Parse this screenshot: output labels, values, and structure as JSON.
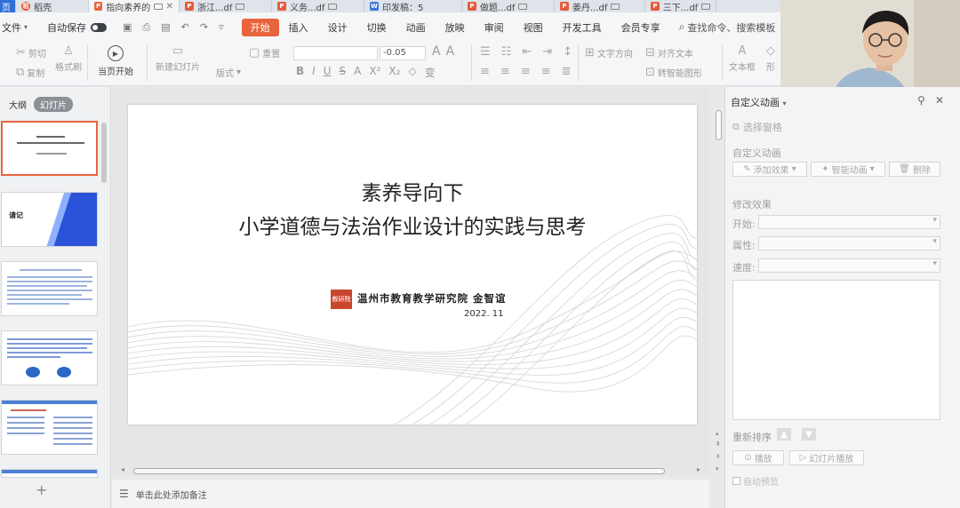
{
  "tabs": [
    {
      "label": "页",
      "type": "home"
    },
    {
      "label": "稻壳",
      "type": "brand"
    },
    {
      "label": "指向素养的",
      "type": "ppt",
      "active": true
    },
    {
      "label": "浙江...df",
      "type": "pdf"
    },
    {
      "label": "义务...df",
      "type": "pdf"
    },
    {
      "label": "印发稿：5",
      "type": "doc"
    },
    {
      "label": "做题...df",
      "type": "pdf"
    },
    {
      "label": "姜丹...df",
      "type": "pdf"
    },
    {
      "label": "三下...df",
      "type": "pdf"
    }
  ],
  "menubar": {
    "file_label": "文件",
    "autosave_label": "自动保存",
    "items": [
      "开始",
      "插入",
      "设计",
      "切换",
      "动画",
      "放映",
      "审阅",
      "视图",
      "开发工具",
      "会员专享"
    ],
    "active_index": 0,
    "search_placeholder": "查找命令、搜索模板"
  },
  "ribbon": {
    "cut": "剪切",
    "copy": "复制",
    "format_painter": "格式刷",
    "from_current": "当页开始",
    "new_slide": "新建幻灯片",
    "layout": "版式",
    "reset": "重置",
    "font_size_delta": "-0.05",
    "textbox_dir": "文字方向",
    "align_text": "对齐文本",
    "smartart": "转智能图形",
    "textbox": "文本框",
    "shape": "形"
  },
  "left_panel": {
    "tab_outline": "大纲",
    "tab_slides": "幻灯片",
    "thumb2_text": "请记",
    "add": "+"
  },
  "slide": {
    "title_line1": "素养导向下",
    "title_line2": "小学道德与法治作业设计的实践与思考",
    "seal_text": "教研院",
    "org": "温州市教育教学研究院 金智谊",
    "date": "2022. 11"
  },
  "notes_placeholder": "单击此处添加备注",
  "right_panel": {
    "title": "自定义动画",
    "select_pane": "选择窗格",
    "section_custom": "自定义动画",
    "add_effect": "添加效果",
    "smart_anim": "智能动画",
    "delete": "删除",
    "section_modify": "修改效果",
    "start_label": "开始:",
    "property_label": "属性:",
    "speed_label": "速度:",
    "reorder_label": "重新排序",
    "play": "播放",
    "slideshow": "幻灯片播放",
    "autopreview": "自动预览"
  },
  "colors": {
    "accent": "#e8643c",
    "home_tab": "#2f6fd8",
    "pdf": "#e45a3b",
    "doc": "#3c77d8"
  }
}
